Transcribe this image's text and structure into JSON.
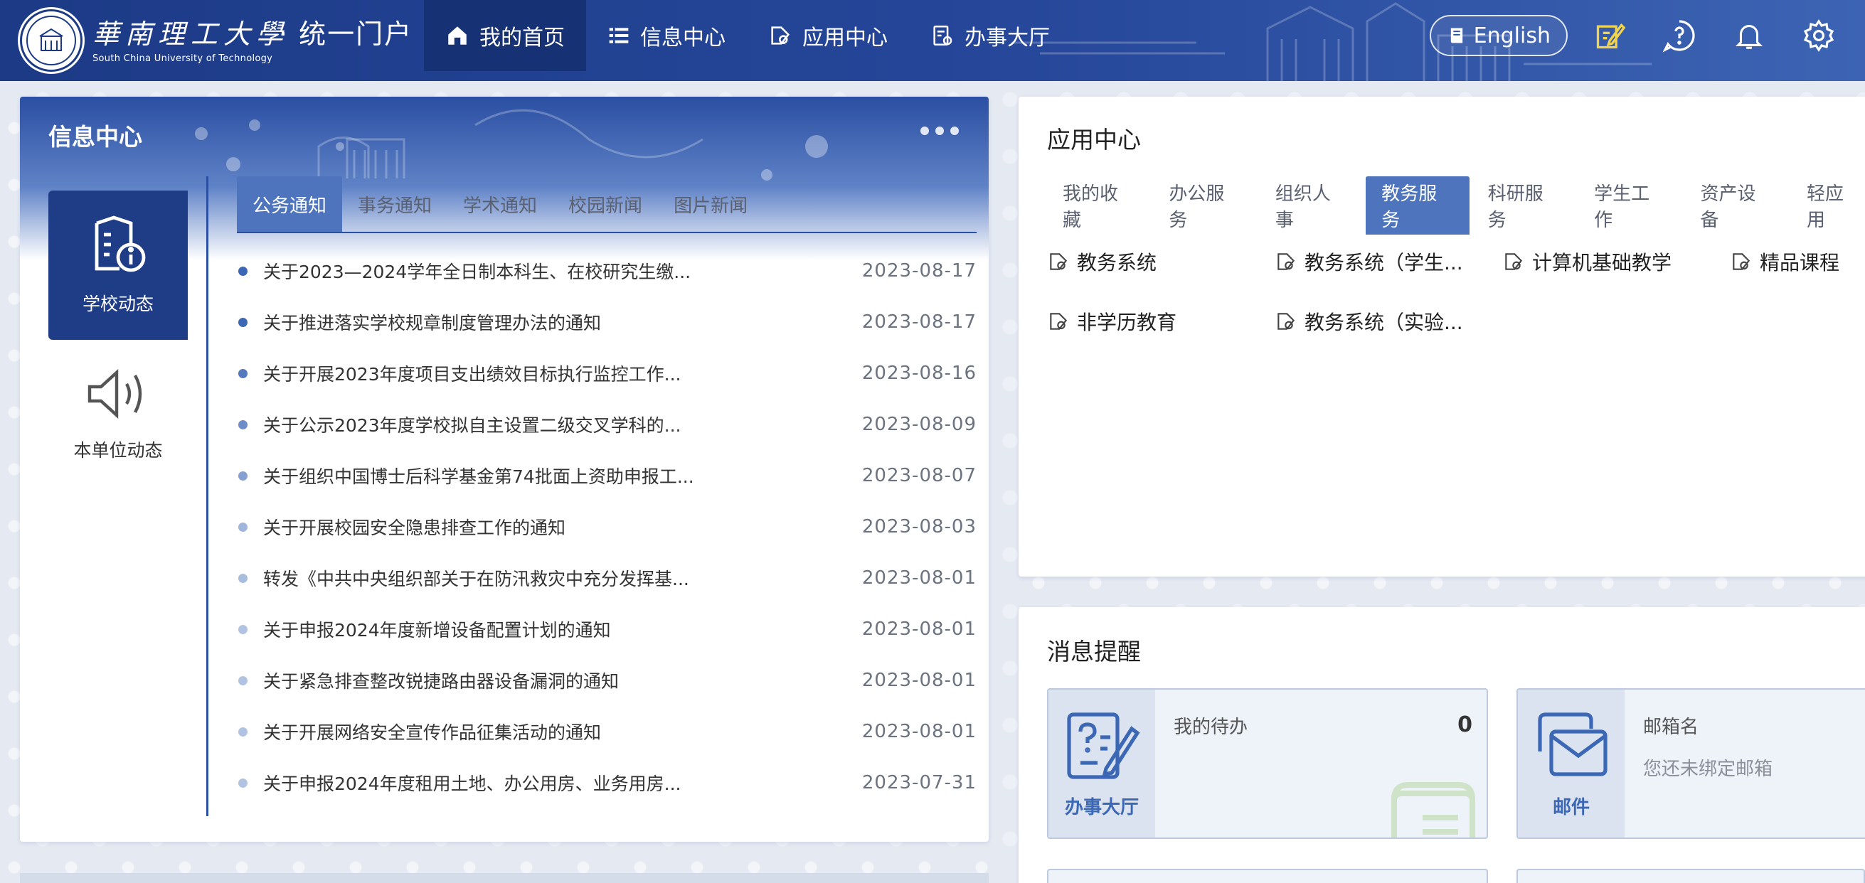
{
  "header": {
    "univ_name_cn": "華南理工大學",
    "univ_name_en": "South China University of Technology",
    "portal_title": "· 统一门户",
    "nav": [
      {
        "label": "我的首页",
        "icon": "home-icon"
      },
      {
        "label": "信息中心",
        "icon": "list-icon"
      },
      {
        "label": "应用中心",
        "icon": "apps-gear-icon"
      },
      {
        "label": "办事大厅",
        "icon": "clipboard-gear-icon"
      }
    ],
    "lang_label": "English",
    "icons": [
      "edit-icon",
      "help-icon",
      "bell-icon",
      "settings-icon"
    ]
  },
  "info_center": {
    "title": "信息中心",
    "side_tabs": [
      {
        "label": "学校动态",
        "icon": "document-info-icon"
      },
      {
        "label": "本单位动态",
        "icon": "speaker-icon"
      }
    ],
    "tabs": [
      "公务通知",
      "事务通知",
      "学术通知",
      "校园新闻",
      "图片新闻"
    ],
    "news": [
      {
        "title": "关于2023—2024学年全日制本科生、在校研究生缴...",
        "date": "2023-08-17"
      },
      {
        "title": "关于推进落实学校规章制度管理办法的通知",
        "date": "2023-08-17"
      },
      {
        "title": "关于开展2023年度项目支出绩效目标执行监控工作...",
        "date": "2023-08-16"
      },
      {
        "title": "关于公示2023年度学校拟自主设置二级交叉学科的...",
        "date": "2023-08-09"
      },
      {
        "title": "关于组织中国博士后科学基金第74批面上资助申报工...",
        "date": "2023-08-07"
      },
      {
        "title": "关于开展校园安全隐患排查工作的通知",
        "date": "2023-08-03"
      },
      {
        "title": "转发《中共中央组织部关于在防汛救灾中充分发挥基...",
        "date": "2023-08-01"
      },
      {
        "title": "关于申报2024年度新增设备配置计划的通知",
        "date": "2023-08-01"
      },
      {
        "title": "关于紧急排查整改锐捷路由器设备漏洞的通知",
        "date": "2023-08-01"
      },
      {
        "title": "关于开展网络安全宣传作品征集活动的通知",
        "date": "2023-08-01"
      },
      {
        "title": "关于申报2024年度租用土地、办公用房、业务用房...",
        "date": "2023-07-31"
      }
    ]
  },
  "app_center": {
    "title": "应用中心",
    "tabs": [
      "我的收藏",
      "办公服务",
      "组织人事",
      "教务服务",
      "科研服务",
      "学生工作",
      "资产设备",
      "轻应用"
    ],
    "active_tab": "教务服务",
    "apps": [
      "教务系统",
      "教务系统（学生...",
      "计算机基础教学",
      "精品课程",
      "非学历教育",
      "教务系统（实验..."
    ]
  },
  "messages": {
    "title": "消息提醒",
    "cards": [
      {
        "icon_label": "办事大厅",
        "name": "我的待办",
        "count": "0"
      },
      {
        "icon_label": "邮件",
        "name": "邮箱名",
        "sub": "您还未绑定邮箱"
      }
    ]
  },
  "colors": {
    "primary": "#1f3c87",
    "tab_active": "#4d74bd",
    "bullet_dark": "#3b67b5",
    "bullet_light": "#9fb5d9",
    "edit_icon": "#f2d44a"
  }
}
